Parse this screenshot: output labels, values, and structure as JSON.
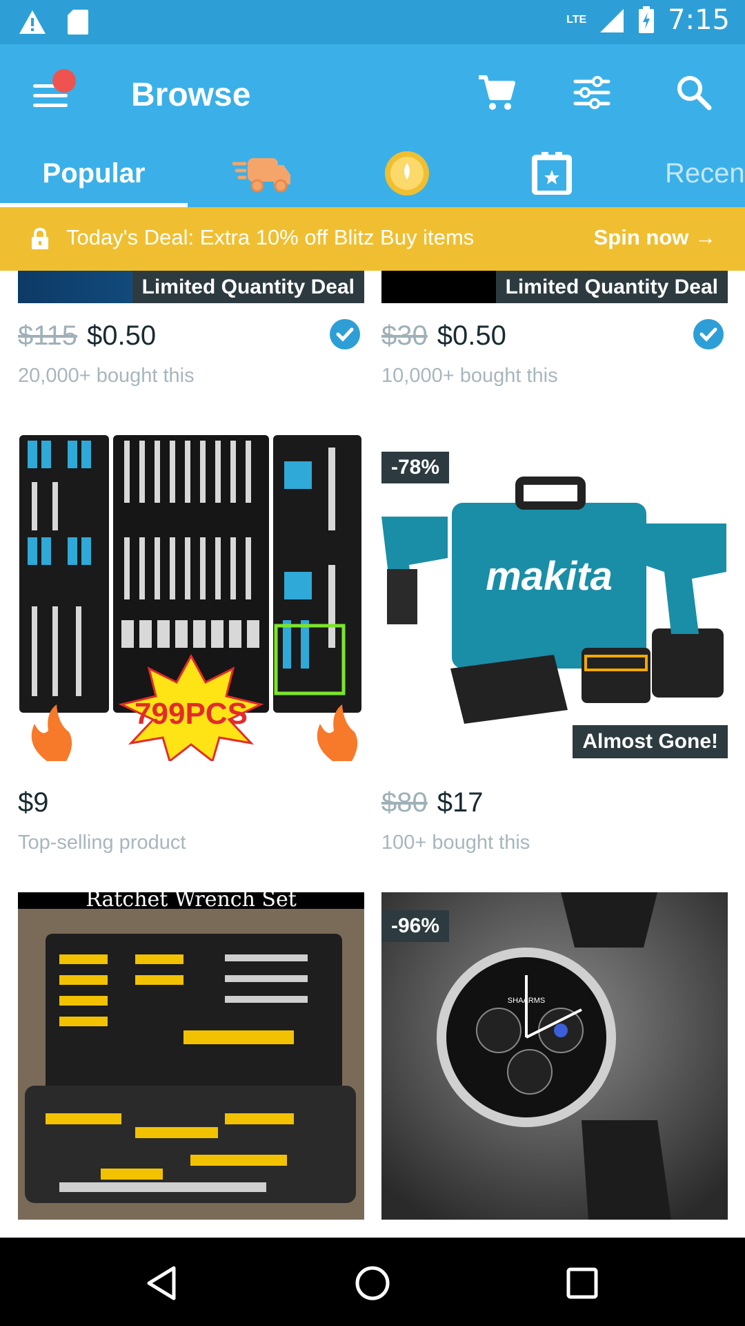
{
  "status_bar": {
    "time": "7:15",
    "network": "LTE"
  },
  "app_bar": {
    "title": "Browse"
  },
  "tabs": [
    {
      "label": "Popular",
      "selected": true
    },
    {
      "icon": "truck-icon"
    },
    {
      "icon": "coin-icon"
    },
    {
      "icon": "badge-icon"
    },
    {
      "label": "Recen"
    }
  ],
  "deal_banner": {
    "text": "Today's Deal: Extra 10% off Blitz Buy items",
    "cta": "Spin now →"
  },
  "products": [
    {
      "badge": "Limited Quantity Deal",
      "old_price": "$115",
      "price": "$0.50",
      "sub": "20,000+ bought this",
      "verified": true
    },
    {
      "badge": "Limited Quantity Deal",
      "old_price": "$30",
      "price": "$0.50",
      "sub": "10,000+ bought this",
      "verified": true
    },
    {
      "image_text": "799PCS",
      "price": "$9",
      "sub": "Top-selling product"
    },
    {
      "discount": "-78%",
      "image_text": "makita",
      "tag": "Almost Gone!",
      "old_price": "$80",
      "price": "$17",
      "sub": "100+ bought this"
    },
    {
      "image_caption": "Ratchet Wrench Set"
    },
    {
      "discount": "-96%",
      "image_text": "SHAARMS"
    }
  ]
}
